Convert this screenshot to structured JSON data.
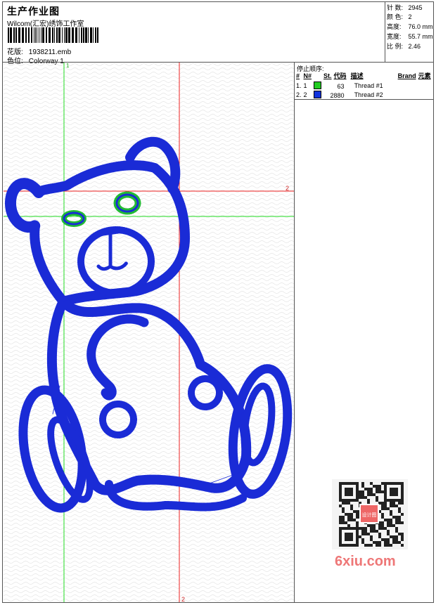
{
  "header": {
    "title": "生产作业图",
    "company": "Wilcom(汇宏)绣饰工作室",
    "design_label": "花版:",
    "design_value": "1938211.emb",
    "colorway_label": "色位:",
    "colorway_value": "Colorway 1"
  },
  "stats": [
    {
      "label": "针 数:",
      "value": "2945"
    },
    {
      "label": "颜 色:",
      "value": "2"
    },
    {
      "label": "高度:",
      "value": "76.0 mm"
    },
    {
      "label": "宽度:",
      "value": "55.7 mm"
    },
    {
      "label": "比 例:",
      "value": "2.46"
    }
  ],
  "stop_sequence": {
    "title": "停止顺序:",
    "columns": [
      "#",
      "N#",
      "St.",
      "代码",
      "描述",
      "Brand",
      "元素"
    ],
    "rows": [
      {
        "num": "1.",
        "n": "1",
        "color": "#22cc22",
        "stitches": "63",
        "description": "Thread #1"
      },
      {
        "num": "2.",
        "n": "2",
        "color": "#1133dd",
        "stitches": "2880",
        "description": "Thread #2"
      }
    ]
  },
  "canvas": {
    "axis_labels": {
      "green_v": "1",
      "red_h": "2",
      "red_v": "2"
    },
    "thread_colors": {
      "outline": "#1a2bd6",
      "accent": "#22bb33"
    }
  },
  "watermark": "6xiu.com",
  "qr_stamp": "设计图"
}
